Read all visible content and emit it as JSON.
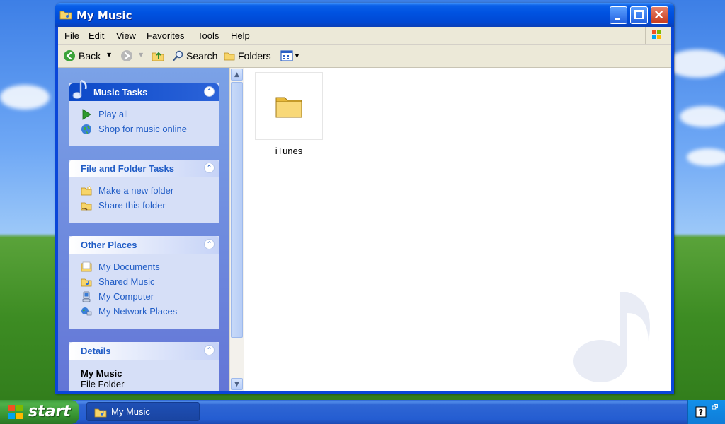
{
  "window": {
    "title": "My Music"
  },
  "menu": [
    "File",
    "Edit",
    "View",
    "Favorites",
    "Tools",
    "Help"
  ],
  "toolbar": {
    "back": "Back",
    "search": "Search",
    "folders": "Folders"
  },
  "music_tasks": {
    "title": "Music Tasks",
    "items": [
      "Play all",
      "Shop for music online"
    ]
  },
  "file_folder_tasks": {
    "title": "File and Folder Tasks",
    "items": [
      "Make a new folder",
      "Share this folder"
    ]
  },
  "other_places": {
    "title": "Other Places",
    "items": [
      "My Documents",
      "Shared Music",
      "My Computer",
      "My Network Places"
    ]
  },
  "details": {
    "title": "Details",
    "name": "My Music",
    "type": "File Folder"
  },
  "content": {
    "items": [
      {
        "label": "iTunes",
        "icon": "folder-icon"
      }
    ]
  },
  "taskbar": {
    "start": "start",
    "window_button": "My Music"
  },
  "colors": {
    "title_bar": "#0053e1",
    "link": "#215dc6",
    "task_pane": "#6375d6"
  }
}
